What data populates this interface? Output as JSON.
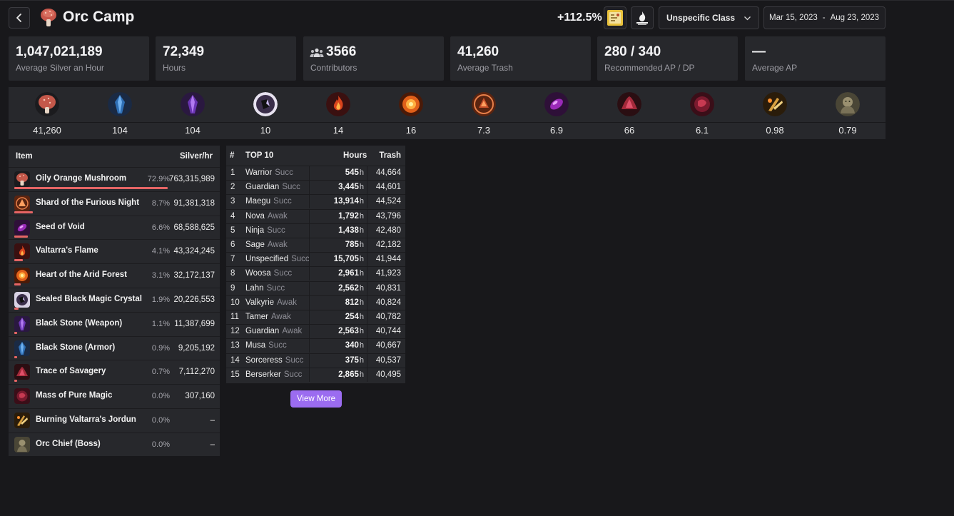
{
  "header": {
    "title": "Orc Camp",
    "bonus": "+112.5%",
    "class_select": "Unspecific Class",
    "date_from": "Mar 15, 2023",
    "date_sep": "-",
    "date_to": "Aug 23, 2023",
    "icons": [
      "back-arrow-icon",
      "mushroom-icon",
      "treasure-map-icon",
      "campfire-icon",
      "chevron-down-icon"
    ]
  },
  "stats": [
    {
      "value": "1,047,021,189",
      "label": "Average Silver an Hour"
    },
    {
      "value": "72,349",
      "label": "Hours"
    },
    {
      "value": "3566",
      "label": "Contributors"
    },
    {
      "value": "41,260",
      "label": "Average Trash"
    },
    {
      "value": "280 / 340",
      "label": "Recommended AP / DP"
    },
    {
      "value": "—",
      "label": "Average AP"
    }
  ],
  "drops": [
    {
      "value": "41,260",
      "icon": "mushroom-icon"
    },
    {
      "value": "104",
      "icon": "blue-crystal-icon"
    },
    {
      "value": "104",
      "icon": "purple-crystal-icon"
    },
    {
      "value": "10",
      "icon": "magic-crystal-icon"
    },
    {
      "value": "14",
      "icon": "flame-icon"
    },
    {
      "value": "16",
      "icon": "fire-heart-icon"
    },
    {
      "value": "7.3",
      "icon": "shard-icon"
    },
    {
      "value": "6.9",
      "icon": "seed-icon"
    },
    {
      "value": "66",
      "icon": "savagery-icon"
    },
    {
      "value": "6.1",
      "icon": "pure-magic-icon"
    },
    {
      "value": "0.98",
      "icon": "jordun-icon"
    },
    {
      "value": "0.79",
      "icon": "orc-chief-icon"
    }
  ],
  "items_table": {
    "col_item": "Item",
    "col_silver": "Silver/hr",
    "rows": [
      {
        "name": "Oily Orange Mushroom",
        "pct": "72.9%",
        "silver": "763,315,989",
        "share": 72.9,
        "icon": "mushroom-icon"
      },
      {
        "name": "Shard of the Furious Night",
        "pct": "8.7%",
        "silver": "91,381,318",
        "share": 8.7,
        "icon": "shard-icon"
      },
      {
        "name": "Seed of Void",
        "pct": "6.6%",
        "silver": "68,588,625",
        "share": 6.6,
        "icon": "seed-icon"
      },
      {
        "name": "Valtarra's Flame",
        "pct": "4.1%",
        "silver": "43,324,245",
        "share": 4.1,
        "icon": "flame-icon"
      },
      {
        "name": "Heart of the Arid Forest",
        "pct": "3.1%",
        "silver": "32,172,137",
        "share": 3.1,
        "icon": "fire-heart-icon"
      },
      {
        "name": "Sealed Black Magic Crystal",
        "pct": "1.9%",
        "silver": "20,226,553",
        "share": 1.9,
        "icon": "magic-crystal-icon"
      },
      {
        "name": "Black Stone (Weapon)",
        "pct": "1.1%",
        "silver": "11,387,699",
        "share": 1.1,
        "icon": "purple-crystal-icon"
      },
      {
        "name": "Black Stone (Armor)",
        "pct": "0.9%",
        "silver": "9,205,192",
        "share": 0.9,
        "icon": "blue-crystal-icon"
      },
      {
        "name": "Trace of Savagery",
        "pct": "0.7%",
        "silver": "7,112,270",
        "share": 0.7,
        "icon": "savagery-icon"
      },
      {
        "name": "Mass of Pure Magic",
        "pct": "0.0%",
        "silver": "307,160",
        "share": 0.0,
        "icon": "pure-magic-icon"
      },
      {
        "name": "Burning Valtarra's Jordun",
        "pct": "0.0%",
        "silver": "–",
        "share": 0.0,
        "icon": "jordun-icon"
      },
      {
        "name": "Orc Chief (Boss)",
        "pct": "0.0%",
        "silver": "–",
        "share": 0.0,
        "icon": "orc-chief-icon"
      }
    ]
  },
  "top10": {
    "col_rank": "#",
    "col_name": "TOP 10",
    "col_hours": "Hours",
    "col_trash": "Trash",
    "hours_unit": "h",
    "rows": [
      {
        "rank": "1",
        "class": "Warrior",
        "spec": "Succ",
        "hours": "545",
        "trash": "44,664"
      },
      {
        "rank": "2",
        "class": "Guardian",
        "spec": "Succ",
        "hours": "3,445",
        "trash": "44,601"
      },
      {
        "rank": "3",
        "class": "Maegu",
        "spec": "Succ",
        "hours": "13,914",
        "trash": "44,524"
      },
      {
        "rank": "4",
        "class": "Nova",
        "spec": "Awak",
        "hours": "1,792",
        "trash": "43,796"
      },
      {
        "rank": "5",
        "class": "Ninja",
        "spec": "Succ",
        "hours": "1,438",
        "trash": "42,480"
      },
      {
        "rank": "6",
        "class": "Sage",
        "spec": "Awak",
        "hours": "785",
        "trash": "42,182"
      },
      {
        "rank": "7",
        "class": "Unspecified",
        "spec": "Succ",
        "hours": "15,705",
        "trash": "41,944"
      },
      {
        "rank": "8",
        "class": "Woosa",
        "spec": "Succ",
        "hours": "2,961",
        "trash": "41,923"
      },
      {
        "rank": "9",
        "class": "Lahn",
        "spec": "Succ",
        "hours": "2,562",
        "trash": "40,831"
      },
      {
        "rank": "10",
        "class": "Valkyrie",
        "spec": "Awak",
        "hours": "812",
        "trash": "40,824"
      },
      {
        "rank": "11",
        "class": "Tamer",
        "spec": "Awak",
        "hours": "254",
        "trash": "40,782"
      },
      {
        "rank": "12",
        "class": "Guardian",
        "spec": "Awak",
        "hours": "2,563",
        "trash": "40,744"
      },
      {
        "rank": "13",
        "class": "Musa",
        "spec": "Succ",
        "hours": "340",
        "trash": "40,667"
      },
      {
        "rank": "14",
        "class": "Sorceress",
        "spec": "Succ",
        "hours": "375",
        "trash": "40,537"
      },
      {
        "rank": "15",
        "class": "Berserker",
        "spec": "Succ",
        "hours": "2,865",
        "trash": "40,495"
      }
    ],
    "view_more": "View More"
  },
  "colors": {
    "background": "#18181b",
    "panel": "#27282c",
    "share_bar": "#e56565",
    "accent_button": "#9b6cf0"
  }
}
